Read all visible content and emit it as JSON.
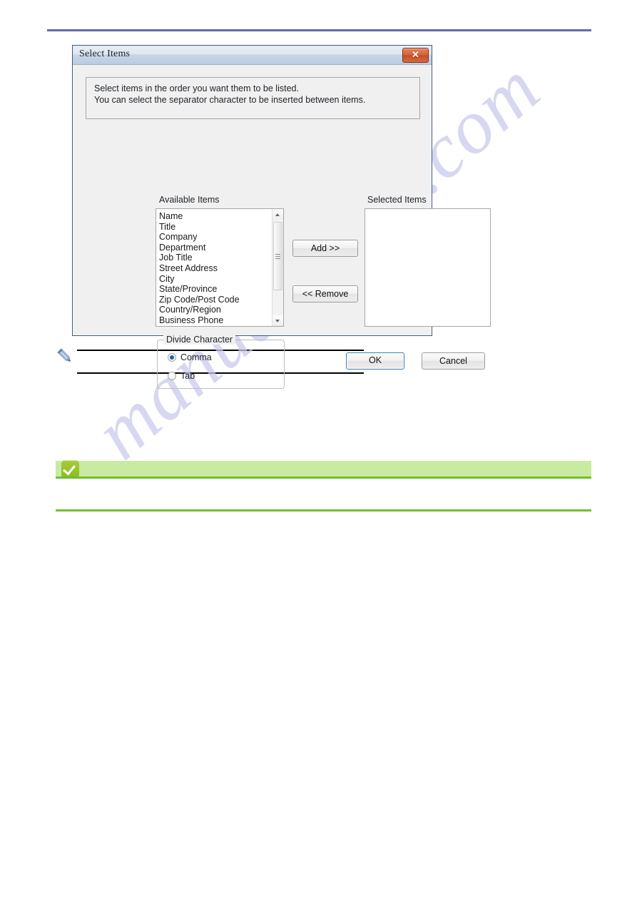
{
  "page": {
    "watermark_text": "manualshive.com",
    "top_rule_color": "#5b6bb0"
  },
  "dialog": {
    "title": "Select Items",
    "close_glyph": "✕",
    "info_line1": "Select items in the order you want them to be listed.",
    "info_line2": "You can select the separator character to be inserted between items.",
    "available_label": "Available Items",
    "selected_label": "Selected Items",
    "available_items": [
      "Name",
      "Title",
      "Company",
      "Department",
      "Job Title",
      "Street Address",
      "City",
      "State/Province",
      "Zip Code/Post Code",
      "Country/Region",
      "Business Phone"
    ],
    "selected_items": [],
    "add_label": "Add >>",
    "remove_label": "<< Remove",
    "divide_character": {
      "group_label": "Divide Character",
      "options": [
        {
          "label": "Comma",
          "selected": true
        },
        {
          "label": "Tab",
          "selected": false
        }
      ]
    },
    "ok_label": "OK",
    "cancel_label": "Cancel",
    "accent_focus_color": "#3c7fb1",
    "close_button_color": "#c24f27"
  },
  "note_block": {
    "icon": "pencil-icon",
    "body_text": ""
  },
  "tip_block": {
    "icon": "check-badge-icon",
    "banner_color": "#c8eba1",
    "rule_color": "#6fc02c",
    "heading_text": "",
    "body_text": ""
  }
}
